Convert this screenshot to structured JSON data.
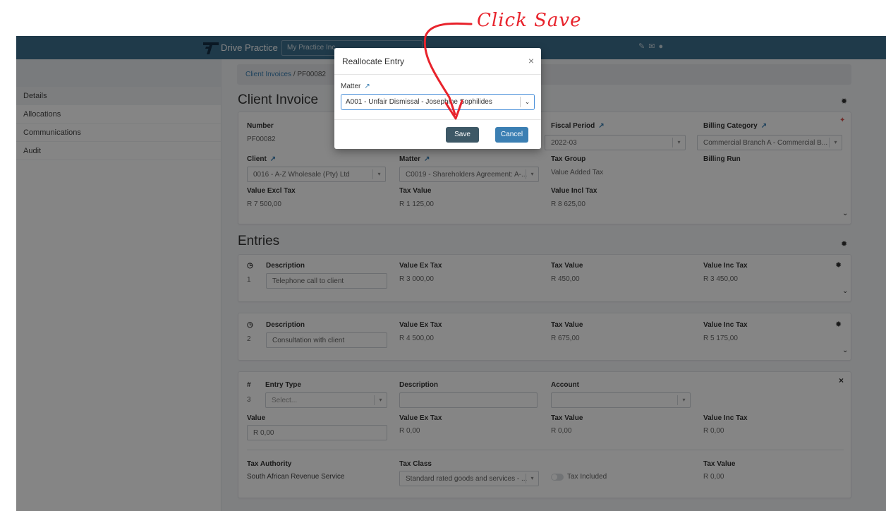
{
  "annotation": {
    "text": "Click Save",
    "color": "#e8232c"
  },
  "app": {
    "title": "Drive Practice",
    "practice_select": "My Practice Inc.",
    "header_color": "#3d6f8e"
  },
  "sidebar": {
    "items": [
      {
        "label": "Details"
      },
      {
        "label": "Allocations"
      },
      {
        "label": "Communications"
      },
      {
        "label": "Audit"
      }
    ]
  },
  "breadcrumb": {
    "parent": "Client Invoices",
    "separator": "/",
    "current": "PF00082"
  },
  "invoice": {
    "section_title": "Client Invoice",
    "number_label": "Number",
    "number_value": "PF00082",
    "fiscal_period_label": "Fiscal Period",
    "fiscal_period_value": "2022-03",
    "billing_category_label": "Billing Category",
    "billing_category_value": "Commercial Branch A - Commercial B...",
    "client_label": "Client",
    "client_value": "0016 - A-Z Wholesale (Pty) Ltd",
    "matter_label": "Matter",
    "matter_value": "C0019 - Shareholders Agreement: A-...",
    "tax_group_label": "Tax Group",
    "tax_group_value": "Value Added Tax",
    "billing_run_label": "Billing Run",
    "value_excl_label": "Value Excl Tax",
    "value_excl_value": "R 7 500,00",
    "tax_value_label": "Tax Value",
    "tax_value_value": "R 1 125,00",
    "value_incl_label": "Value Incl Tax",
    "value_incl_value": "R 8 625,00"
  },
  "entries": {
    "section_title": "Entries",
    "rows": [
      {
        "index": "1",
        "description_label": "Description",
        "description": "Telephone call to client",
        "ex_label": "Value Ex Tax",
        "ex": "R 3 000,00",
        "tax_label": "Tax Value",
        "tax": "R 450,00",
        "inc_label": "Value Inc Tax",
        "inc": "R 3 450,00"
      },
      {
        "index": "2",
        "description_label": "Description",
        "description": "Consultation with client",
        "ex_label": "Value Ex Tax",
        "ex": "R 4 500,00",
        "tax_label": "Tax Value",
        "tax": "R 675,00",
        "inc_label": "Value Inc Tax",
        "inc": "R 5 175,00"
      }
    ],
    "new_entry": {
      "hash": "#",
      "index": "3",
      "entry_type_label": "Entry Type",
      "entry_type_placeholder": "Select...",
      "description_label": "Description",
      "account_label": "Account",
      "value_label": "Value",
      "value": "R 0,00",
      "ex_label": "Value Ex Tax",
      "ex": "R 0,00",
      "tax_label": "Tax Value",
      "tax": "R 0,00",
      "inc_label": "Value Inc Tax",
      "inc": "R 0,00",
      "tax_authority_label": "Tax Authority",
      "tax_authority": "South African Revenue Service",
      "tax_class_label": "Tax Class",
      "tax_class": "Standard rated goods and services - ...",
      "tax_included_label": "Tax Included",
      "tax_value_label": "Tax Value",
      "tax_value": "R 0,00"
    }
  },
  "modal": {
    "title": "Reallocate Entry",
    "close": "×",
    "matter_label": "Matter",
    "matter_value": "A001 - Unfair Dismissal - Josephine Sophilides",
    "save_label": "Save",
    "cancel_label": "Cancel"
  }
}
